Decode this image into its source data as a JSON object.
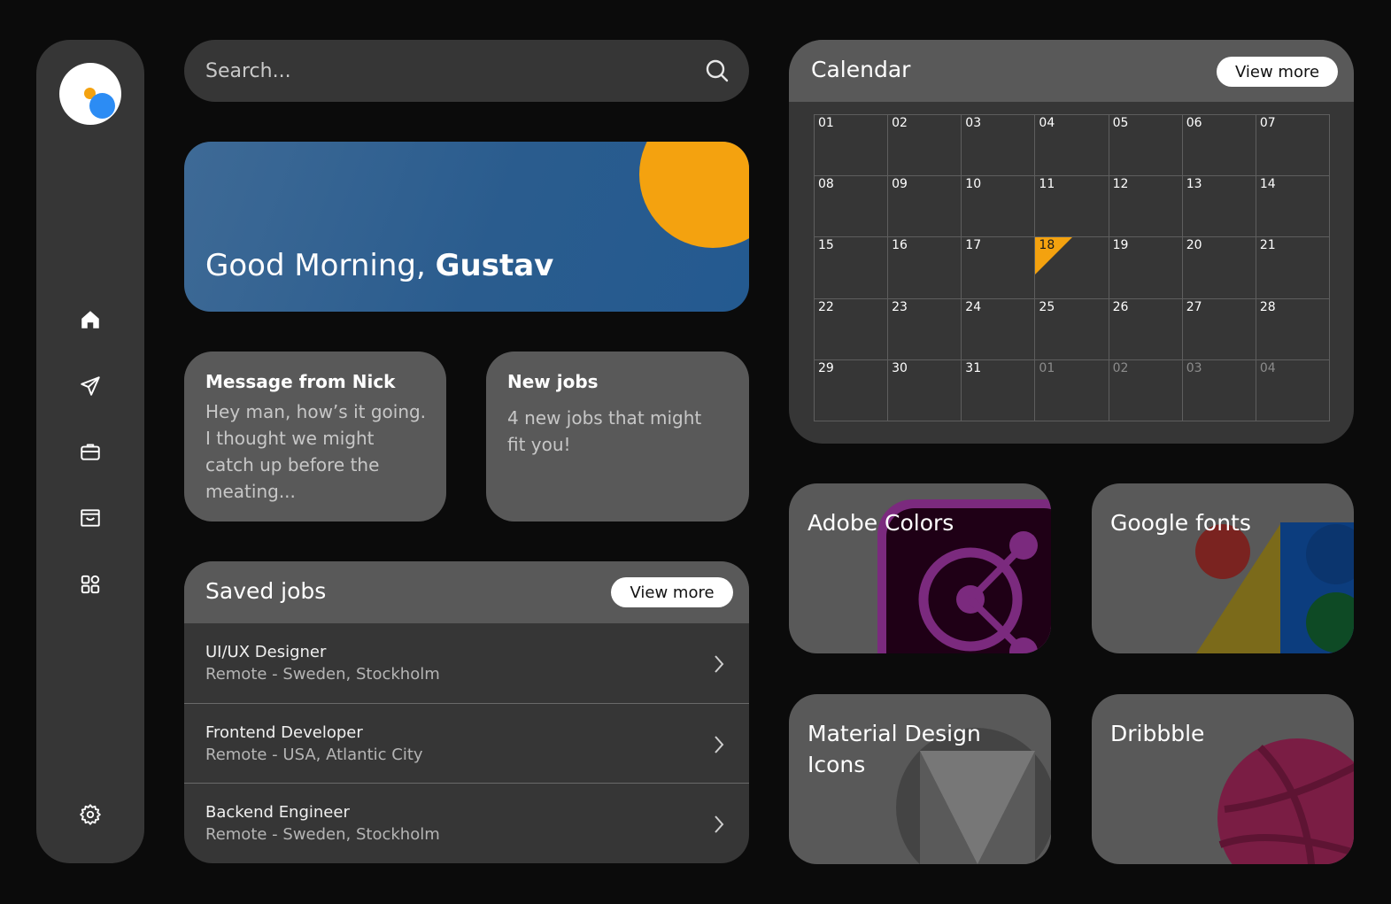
{
  "colors": {
    "background": "#0b0b0b",
    "panel": "#363636",
    "card": "#595959",
    "accent_orange": "#f4a20f",
    "accent_blue": "#2c8cf4",
    "greeting_blue": "#2a5c8e"
  },
  "sidebar": {
    "logo": "app-logo",
    "items": [
      {
        "icon": "home-icon",
        "active": true
      },
      {
        "icon": "send-icon"
      },
      {
        "icon": "briefcase-icon"
      },
      {
        "icon": "inbox-icon"
      },
      {
        "icon": "apps-grid-icon"
      }
    ],
    "footer_icon": "settings-icon"
  },
  "search": {
    "placeholder": "Search...",
    "icon": "search-icon"
  },
  "greeting": {
    "prefix": "Good Morning, ",
    "name": "Gustav"
  },
  "message_card": {
    "title": "Message from Nick",
    "body": "Hey man, how’s it going. I thought we might catch up before the meating..."
  },
  "new_jobs_card": {
    "title": "New jobs",
    "body": "4 new jobs that might fit you!"
  },
  "saved_jobs": {
    "title": "Saved jobs",
    "view_more": "View more",
    "items": [
      {
        "title": "UI/UX Designer",
        "location": "Remote - Sweden, Stockholm"
      },
      {
        "title": "Frontend Developer",
        "location": "Remote - USA, Atlantic City"
      },
      {
        "title": "Backend Engineer",
        "location": "Remote - Sweden, Stockholm"
      }
    ]
  },
  "calendar": {
    "title": "Calendar",
    "view_more": "View more",
    "today": "18",
    "days": [
      "01",
      "02",
      "03",
      "04",
      "05",
      "06",
      "07",
      "08",
      "09",
      "10",
      "11",
      "12",
      "13",
      "14",
      "15",
      "16",
      "17",
      "18",
      "19",
      "20",
      "21",
      "22",
      "23",
      "24",
      "25",
      "26",
      "27",
      "28",
      "29",
      "30",
      "31",
      "01",
      "02",
      "03",
      "04"
    ],
    "next_month_start_index": 31
  },
  "resources": [
    {
      "title": "Adobe Colors",
      "icon": "adobe-color-icon"
    },
    {
      "title": "Google fonts",
      "icon": "google-fonts-icon"
    },
    {
      "title": "Material Design Icons",
      "icon": "material-design-icon"
    },
    {
      "title": "Dribbble",
      "icon": "dribbble-icon"
    }
  ]
}
